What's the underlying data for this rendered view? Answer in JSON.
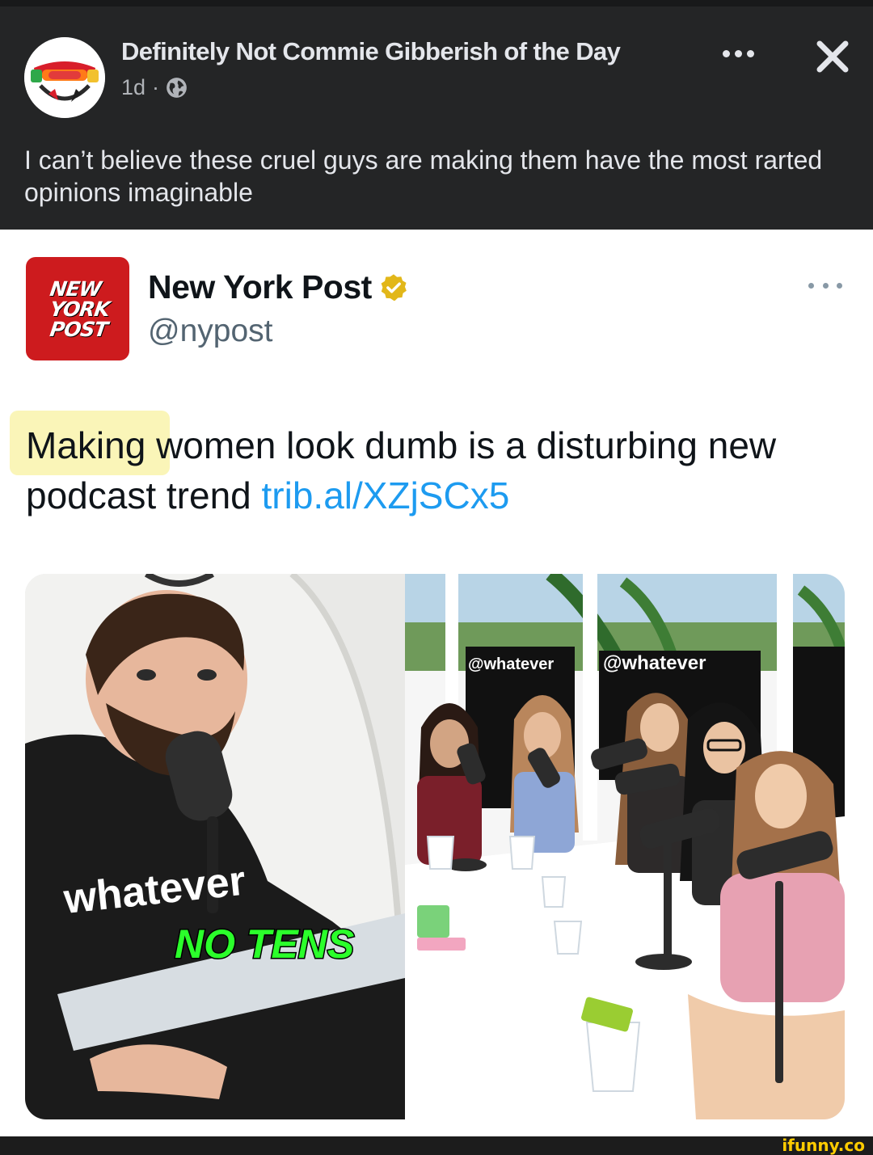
{
  "fb_post": {
    "page_name": "Definitely Not Commie Gibberish of the Day",
    "time": "1d",
    "separator": "·",
    "caption": "I can’t believe these cruel guys are making them have the most rarted opinions imaginable"
  },
  "tweet": {
    "logo_lines": [
      "NEW",
      "YORK",
      "POST"
    ],
    "name": "New York Post",
    "handle": "@nypost",
    "text_before_link": "Making women look dumb is a disturbing new podcast trend ",
    "link": "trib.al/XZjSCx5"
  },
  "media": {
    "hoodie_text": "whatever",
    "caption_overlay": "NO TENS",
    "backdrop_text": "@whatever"
  },
  "watermark": "ifunny.co",
  "colors": {
    "fb_background": "#242526",
    "nyp_red": "#cd1b1e",
    "link_blue": "#1d9bf0",
    "verified_gold": "#e2b719",
    "caption_green": "#2bff2b",
    "highlight_yellow": "#faf5b8"
  }
}
